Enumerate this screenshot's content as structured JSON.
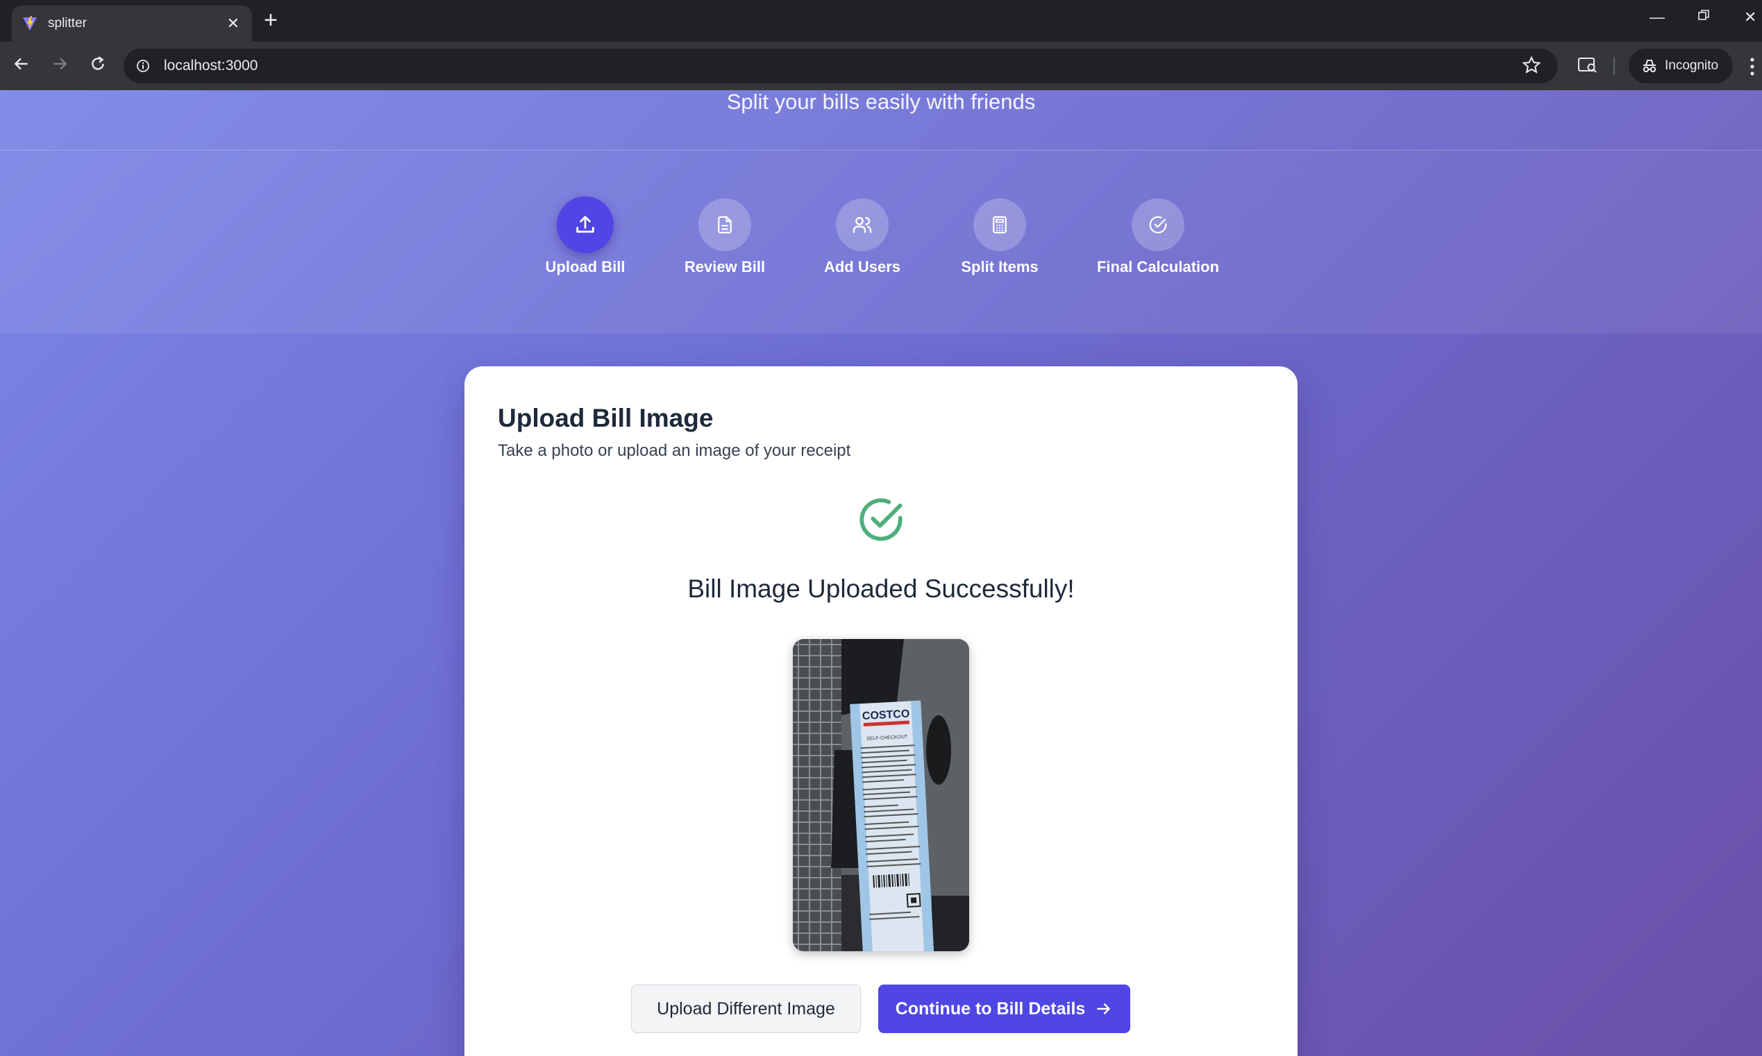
{
  "browser": {
    "tab_title": "splitter",
    "new_tab_symbol": "+",
    "url": "localhost:3000",
    "incognito_label": "Incognito"
  },
  "header": {
    "subtitle": "Split your bills easily with friends"
  },
  "steps": [
    {
      "label": "Upload Bill",
      "icon": "upload-icon",
      "active": true
    },
    {
      "label": "Review Bill",
      "icon": "document-icon",
      "active": false
    },
    {
      "label": "Add Users",
      "icon": "users-icon",
      "active": false
    },
    {
      "label": "Split Items",
      "icon": "calculator-icon",
      "active": false
    },
    {
      "label": "Final Calculation",
      "icon": "check-circle-icon",
      "active": false
    }
  ],
  "upload_card": {
    "title": "Upload Bill Image",
    "description": "Take a photo or upload an image of your receipt",
    "success_message": "Bill Image Uploaded Successfully!",
    "receipt_brand": "COSTCO",
    "receipt_subheading": "SELF-CHECKOUT",
    "upload_different_label": "Upload Different Image",
    "continue_label": "Continue to Bill Details"
  },
  "colors": {
    "accent": "#4f46e5",
    "success": "#4caf7d",
    "gradient_start": "#7b86e6",
    "gradient_end": "#6a4fa8"
  }
}
